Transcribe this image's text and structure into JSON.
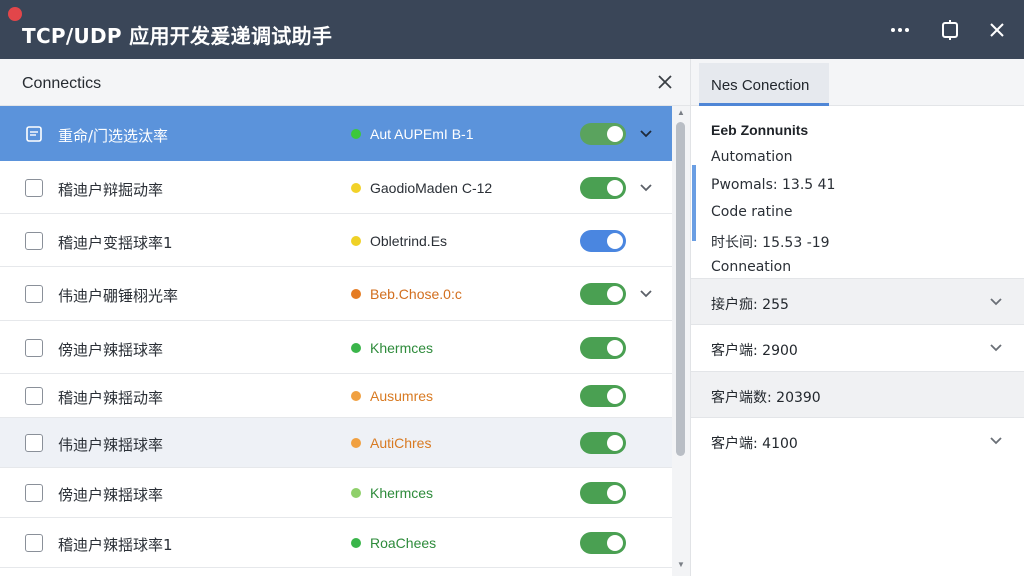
{
  "app": {
    "title": "TCP/UDP 应用开发 爰 递 调试 助手",
    "title_text": "TCP/UDP 应用开发爰递调试助手",
    "menu_icon": "more-horizontal-icon",
    "restore_icon": "restore-window-icon",
    "close_icon": "close-icon"
  },
  "left": {
    "title": "Connectics",
    "close_icon": "close-icon",
    "rows": [
      {
        "name": "重命/门选选汰率",
        "status": "Aut AUPEmI B-1",
        "dot": "#3cc83c",
        "status_color": "#ffffff",
        "toggle": "#5aa35e",
        "chevron": true,
        "selected": true
      },
      {
        "name": "稽迪户辩掘动率",
        "status": "GaodioMaden C-12",
        "dot": "#f2d229",
        "status_color": "#2a2f36",
        "toggle": "#4aa052",
        "chevron": true
      },
      {
        "name": "稽迪户变揺球率1",
        "status": "Obletrind.Es",
        "dot": "#efd126",
        "status_color": "#2a2f36",
        "toggle": "#4a86e0",
        "chevron": false
      },
      {
        "name": "伟迪户硼锤栩光率",
        "status": "Beb.Chose.0:c",
        "dot": "#e57c23",
        "status_color": "#d26f1f",
        "toggle": "#4aa052",
        "chevron": true
      },
      {
        "name": "傍迪户辣揺球率",
        "status": "Khermces",
        "dot": "#3ab54a",
        "status_color": "#2e8b3b",
        "toggle": "#4aa052",
        "chevron": false
      },
      {
        "name": "稽迪户辣揺动率",
        "status": "Ausumres",
        "dot": "#f0a040",
        "status_color": "#d87a22",
        "toggle": "#4aa052",
        "chevron": false
      },
      {
        "name": "伟迪户辣揺球率",
        "status": "AutiChres",
        "dot": "#f0a040",
        "status_color": "#d87a22",
        "toggle": "#4aa052",
        "chevron": false,
        "hover": true
      },
      {
        "name": "傍迪户辣揺球率",
        "status": "Khermces",
        "dot": "#8fd06a",
        "status_color": "#2e8b3b",
        "toggle": "#4aa052",
        "chevron": false
      },
      {
        "name": "稽迪户辣揺球率1",
        "status": "RoaChees",
        "dot": "#3ab54a",
        "status_color": "#2e8b3b",
        "toggle": "#4aa052",
        "chevron": false
      }
    ]
  },
  "right": {
    "tab_label": "Nes Conection",
    "info": {
      "title": "Eeb Zonnunits",
      "lines": [
        "Automation",
        "Pwomals: 13.5 41",
        "Code ratine",
        "时长间: 15.53 -19",
        "Conneation"
      ]
    },
    "accordion": [
      {
        "label": "接户痂: 255",
        "shaded": true,
        "chevron": true
      },
      {
        "label": "客户端: 2900",
        "shaded": false,
        "chevron": true
      },
      {
        "label": "客户端数: 20390",
        "shaded": true,
        "chevron": false
      },
      {
        "label": "客户端: 4100",
        "shaded": false,
        "chevron": true
      }
    ]
  }
}
